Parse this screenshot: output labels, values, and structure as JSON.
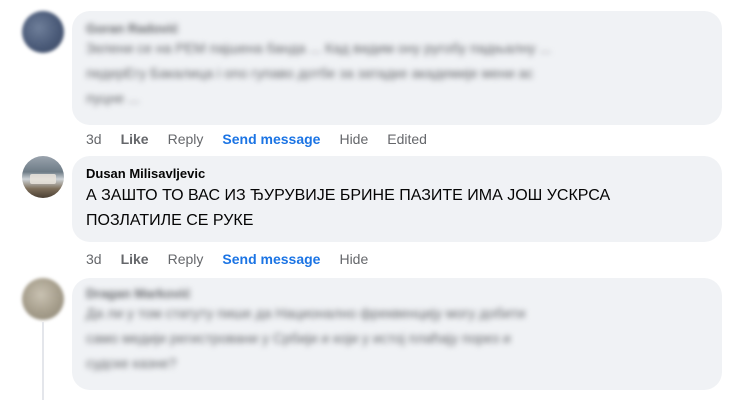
{
  "comments": [
    {
      "author": "Goran Radović",
      "text_lines": [
        "Зелени се на РЕМ пајшена банда ... Кад видим ону ругобу падњалну ...",
        "педерЕгу Бакалица i ono гупаво дотбе за затадке академије мени ас",
        "пуцне ..."
      ],
      "actions": {
        "time": "3d",
        "like": "Like",
        "reply": "Reply",
        "send": "Send message",
        "hide": "Hide",
        "edited": "Edited"
      }
    },
    {
      "author": "Dusan Milisavljevic",
      "text_lines": [
        "А ЗАШТО ТО ВАС ИЗ ЂУРУВИЈЕ БРИНЕ ПАЗИТЕ ИМА ЈОШ УСКРСА",
        "ПОЗЛАТИЛЕ СЕ РУКЕ"
      ],
      "actions": {
        "time": "3d",
        "like": "Like",
        "reply": "Reply",
        "send": "Send message",
        "hide": "Hide"
      }
    },
    {
      "author": "Dragan Marković",
      "text_lines": [
        "Да ли у том статуту пише да Национално фреквенцију могу добити",
        "само медији регистровани у Србији и који у истој плаћају порез и",
        "судске казне?"
      ]
    }
  ],
  "colors": {
    "bubble": "#f0f2f5",
    "link": "#1b74e4",
    "meta": "#65676b",
    "text": "#050505"
  }
}
